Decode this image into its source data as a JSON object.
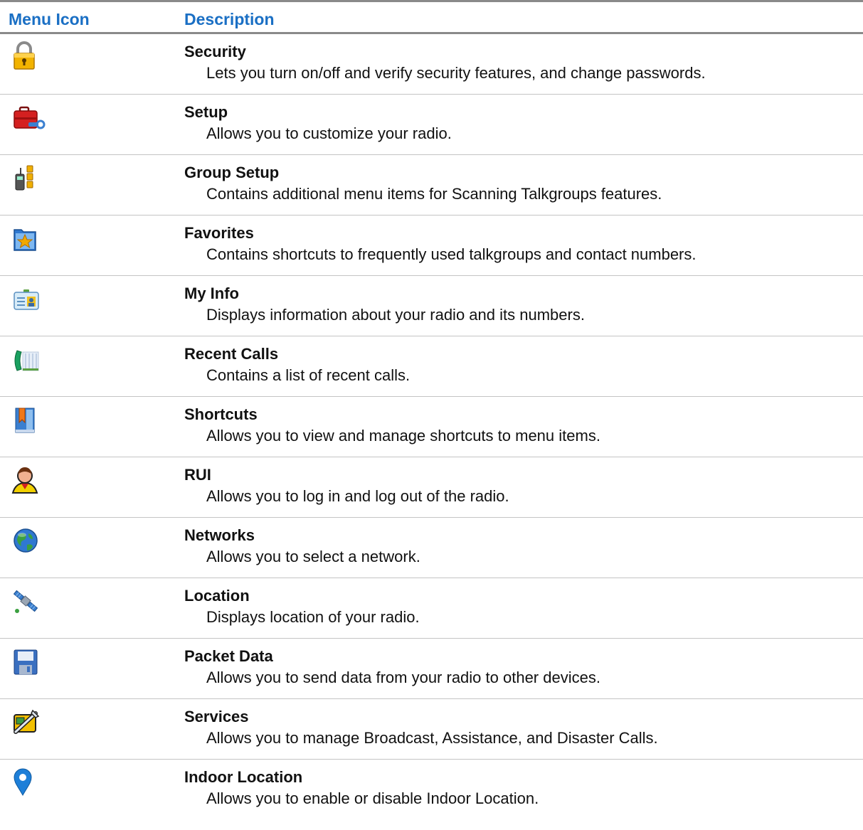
{
  "header": {
    "icon_col": "Menu Icon",
    "desc_col": "Description"
  },
  "colors": {
    "header_text": "#1a6fc4",
    "rule": "#8a8a8a",
    "divider": "#c4c4c4"
  },
  "items": [
    {
      "icon": "padlock-icon",
      "title": "Security",
      "desc": "Lets you turn on/off and verify security features, and change passwords."
    },
    {
      "icon": "toolbox-icon",
      "title": "Setup",
      "desc": "Allows you to customize your radio."
    },
    {
      "icon": "radio-group-icon",
      "title": "Group Setup",
      "desc": "Contains additional menu items for Scanning Talkgroups features."
    },
    {
      "icon": "star-folder-icon",
      "title": "Favorites",
      "desc": "Contains shortcuts to frequently used talkgroups and contact numbers."
    },
    {
      "icon": "id-card-icon",
      "title": "My Info",
      "desc": "Displays information about your radio and its numbers."
    },
    {
      "icon": "phone-list-icon",
      "title": "Recent Calls",
      "desc": "Contains a list of recent calls."
    },
    {
      "icon": "bookmark-book-icon",
      "title": "Shortcuts",
      "desc": "Allows you to view and manage shortcuts to menu items."
    },
    {
      "icon": "user-icon",
      "title": "RUI",
      "desc": "Allows you to log in and log out of the radio."
    },
    {
      "icon": "globe-icon",
      "title": "Networks",
      "desc": "Allows you to select a network."
    },
    {
      "icon": "satellite-icon",
      "title": "Location",
      "desc": "Displays location of your radio."
    },
    {
      "icon": "floppy-disk-icon",
      "title": "Packet Data",
      "desc": "Allows you to send data from your radio to other devices."
    },
    {
      "icon": "services-tools-icon",
      "title": "Services",
      "desc": "Allows you to manage Broadcast, Assistance, and Disaster Calls."
    },
    {
      "icon": "map-pin-icon",
      "title": "Indoor Location",
      "desc": "Allows you to enable or disable Indoor Location."
    }
  ]
}
